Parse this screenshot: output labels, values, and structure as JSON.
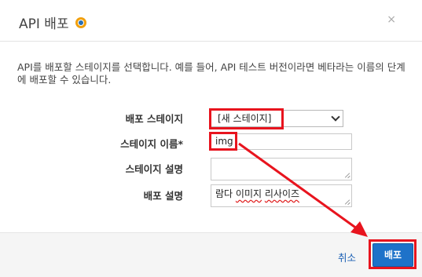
{
  "dialog": {
    "title": "API 배포",
    "close_label": "×"
  },
  "description": "API를 배포할 스테이지를 선택합니다. 예를 들어, API 테스트 버전이라면 베타라는 이름의 단계에 배포할 수 있습니다.",
  "form": {
    "stage_label": "배포 스테이지",
    "stage_value": "[새 스테이지]",
    "stage_name_label": "스테이지 이름*",
    "stage_name_value": "img",
    "stage_desc_label": "스테이지 설명",
    "stage_desc_value": "",
    "deploy_desc_label": "배포 설명",
    "deploy_desc_value_a": "람다 ",
    "deploy_desc_value_b": "이미지",
    "deploy_desc_value_c": " ",
    "deploy_desc_value_d": "리사이즈"
  },
  "footer": {
    "cancel_label": "취소",
    "deploy_label": "배포"
  },
  "colors": {
    "highlight": "#e8141e",
    "primary": "#1e72c9",
    "link": "#1a5fb4"
  }
}
